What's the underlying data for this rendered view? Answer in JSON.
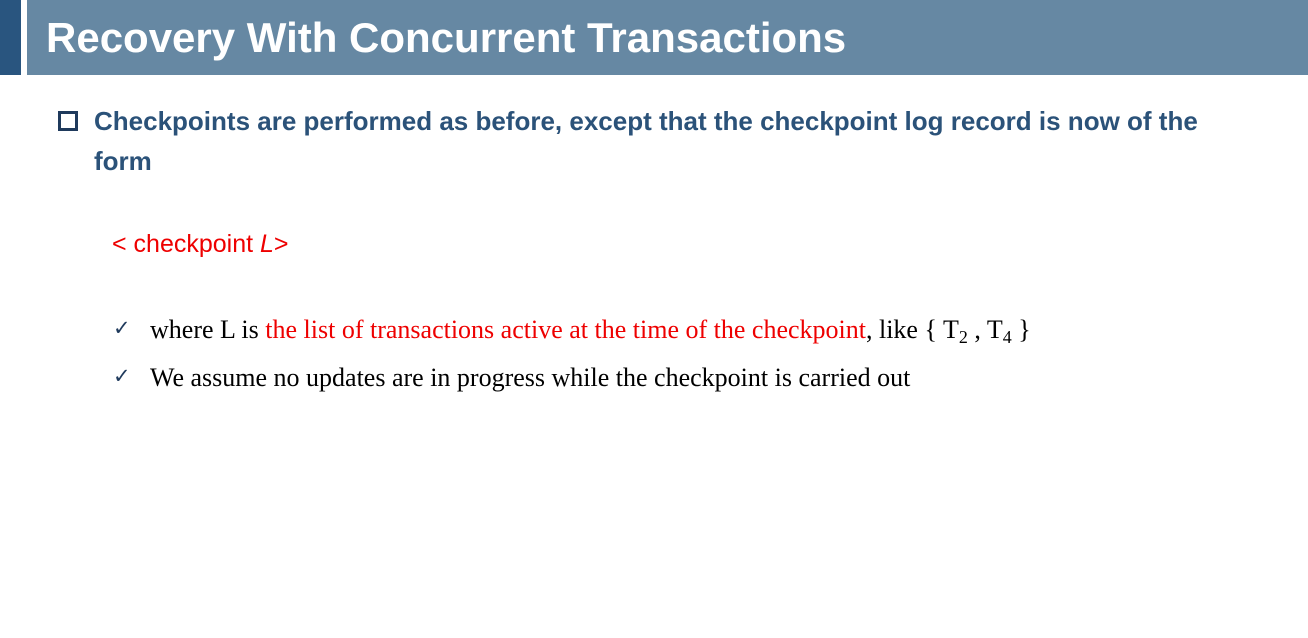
{
  "header": {
    "title": "Recovery With Concurrent Transactions"
  },
  "bullet": {
    "text": "Checkpoints are performed as before, except that the checkpoint log record is now of the form"
  },
  "formula": {
    "open": "< checkpoint ",
    "var": "L",
    "close": ">"
  },
  "items": [
    {
      "pre": "where L is ",
      "highlight": "the list of transactions active at the time of the checkpoint",
      "post": ", like { T",
      "sub1": "2",
      "mid": " , T",
      "sub2": "4",
      "end": " }"
    },
    {
      "text": "We assume no updates are in progress while the checkpoint is carried out"
    }
  ],
  "check_glyph": "✓",
  "colors": {
    "title_bar": "#6688a3",
    "accent_bar": "#29557f",
    "bullet_text": "#2b5279",
    "highlight": "#ee0000"
  }
}
